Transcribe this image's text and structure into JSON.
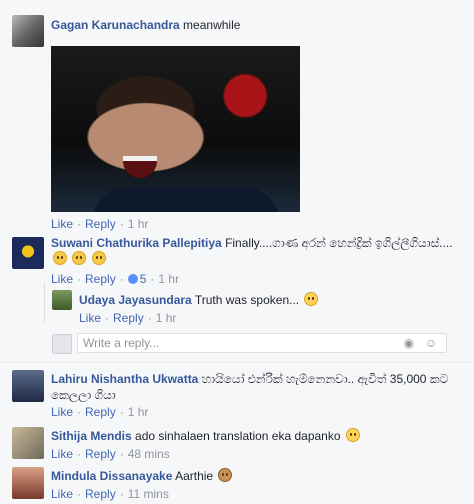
{
  "comments": [
    {
      "name": "Gagan Karunachandra",
      "text": "meanwhile",
      "like": "Like",
      "reply": "Reply",
      "time": "1 hr"
    },
    {
      "name": "Suwani Chathurika Pallepitiya",
      "text": "Finally....ගාණ අරන් හෙන්ද්‍රික් ඉගිල්ලීගියාස්....",
      "like": "Like",
      "reply": "Reply",
      "likes": "5",
      "time": "1 hr"
    },
    {
      "name": "Udaya Jayasundara",
      "text": "Truth was spoken...",
      "like": "Like",
      "reply": "Reply",
      "time": "1 hr"
    },
    {
      "name": "Lahiru Nishantha Ukwatta",
      "text": "හායියෝ එන්රික් හැම්නෙනවා.. ඇවිත් 35,000 කට කෙලලා ගියා",
      "like": "Like",
      "reply": "Reply",
      "time": "1 hr"
    },
    {
      "name": "Sithija Mendis",
      "text": "ado sinhalaen translation eka dapanko",
      "like": "Like",
      "reply": "Reply",
      "time": "48 mins"
    },
    {
      "name": "Mindula Dissanayake",
      "text": "Aarthie",
      "like": "Like",
      "reply": "Reply",
      "time": "11 mins"
    }
  ],
  "reply_box": {
    "placeholder": "Write a reply..."
  },
  "colors": {
    "name_link": "#365899",
    "action_link": "#4267b2",
    "meta": "#90949c",
    "background": "#f6f7f9"
  }
}
